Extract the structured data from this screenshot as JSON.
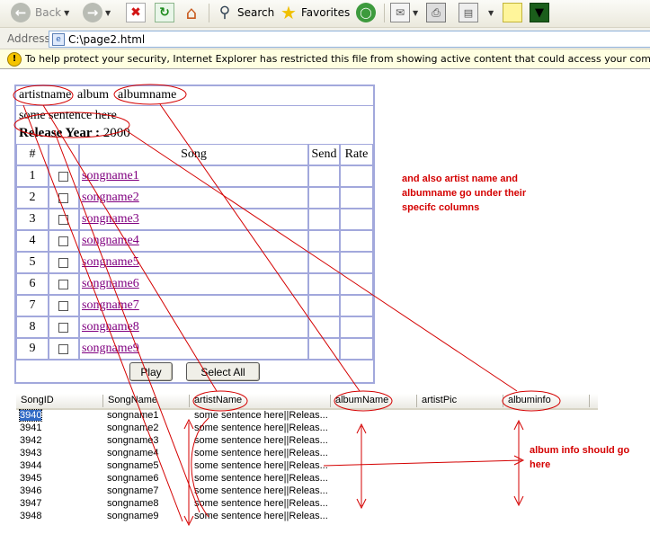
{
  "toolbar": {
    "back_label": "Back",
    "search_label": "Search",
    "favorites_label": "Favorites"
  },
  "address": {
    "label": "Address",
    "value": "C:\\page2.html"
  },
  "infobar": {
    "text": "To help protect your security, Internet Explorer has restricted this file from showing active content that could access your computer. Click here for options..."
  },
  "page": {
    "header": {
      "artist": "artistname",
      "album_word": "album",
      "album": "albumname"
    },
    "sentence": "some sentence here",
    "release_label": "Release Year :",
    "release_year": "2000",
    "columns": {
      "num": "#",
      "song": "Song",
      "send": "Send",
      "rate": "Rate"
    },
    "songs": [
      {
        "num": "1",
        "name": "songname1"
      },
      {
        "num": "2",
        "name": "songname2"
      },
      {
        "num": "3",
        "name": "songname3"
      },
      {
        "num": "4",
        "name": "songname4"
      },
      {
        "num": "5",
        "name": "songname5"
      },
      {
        "num": "6",
        "name": "songname6"
      },
      {
        "num": "7",
        "name": "songname7"
      },
      {
        "num": "8",
        "name": "songname8"
      },
      {
        "num": "9",
        "name": "songname9"
      }
    ],
    "play_label": "Play",
    "select_all_label": "Select All"
  },
  "grid": {
    "columns": [
      "SongID",
      "SongName",
      "artistName",
      "albumName",
      "artistPic",
      "albuminfo"
    ],
    "rows": [
      {
        "id": "3940",
        "name": "songname1",
        "info": "some sentence here||Releas..."
      },
      {
        "id": "3941",
        "name": "songname2",
        "info": "some sentence here||Releas..."
      },
      {
        "id": "3942",
        "name": "songname3",
        "info": "some sentence here||Releas..."
      },
      {
        "id": "3943",
        "name": "songname4",
        "info": "some sentence here||Releas..."
      },
      {
        "id": "3944",
        "name": "songname5",
        "info": "some sentence here||Releas..."
      },
      {
        "id": "3945",
        "name": "songname6",
        "info": "some sentence here||Releas..."
      },
      {
        "id": "3946",
        "name": "songname7",
        "info": "some sentence here||Releas..."
      },
      {
        "id": "3947",
        "name": "songname8",
        "info": "some sentence here||Releas..."
      },
      {
        "id": "3948",
        "name": "songname9",
        "info": "some sentence here||Releas..."
      }
    ]
  },
  "annotations": {
    "note1_lines": [
      "and also artist name and",
      "albumname go under their",
      "specifc columns"
    ],
    "note2_lines": [
      "album info should go",
      "here"
    ],
    "color": "#d40000"
  }
}
